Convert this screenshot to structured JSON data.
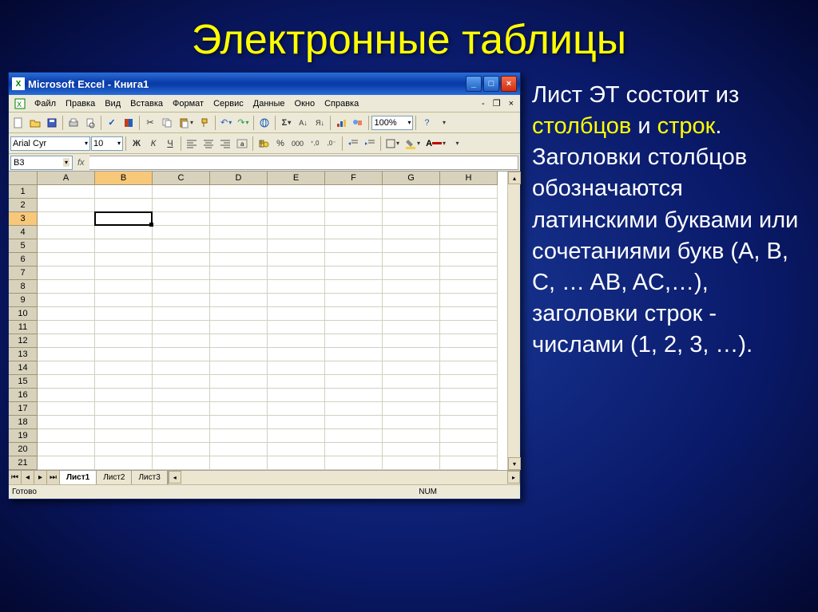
{
  "slide": {
    "title": "Электронные таблицы",
    "body_parts": {
      "p1a": "Лист ЭТ состоит из ",
      "p1b": "столбцов",
      "p1c": " и ",
      "p1d": "строк",
      "p1e": ". Заголовки столбцов обозначаются латинскими буквами или сочетаниями букв (A, B, C, … AB, AC,…), заголовки строк  - числами (1, 2, 3, …)."
    }
  },
  "chart_data": {
    "type": "table",
    "active_cell": "B3",
    "columns": [
      "A",
      "B",
      "C",
      "D",
      "E",
      "F",
      "G",
      "H"
    ],
    "rows": [
      1,
      2,
      3,
      4,
      5,
      6,
      7,
      8,
      9,
      10,
      11,
      12,
      13,
      14,
      15,
      16,
      17,
      18,
      19,
      20,
      21
    ],
    "data": {}
  },
  "excel": {
    "titlebar": "Microsoft Excel - Книга1",
    "menu": {
      "file": "Файл",
      "edit": "Правка",
      "view": "Вид",
      "insert": "Вставка",
      "format": "Формат",
      "tools": "Сервис",
      "data": "Данные",
      "window": "Окно",
      "help": "Справка"
    },
    "toolbar1": {
      "zoom": "100%"
    },
    "toolbar2": {
      "font_name": "Arial Cyr",
      "font_size": "10"
    },
    "namebox": "B3",
    "fx_label": "fx",
    "tabs": {
      "sheet1": "Лист1",
      "sheet2": "Лист2",
      "sheet3": "Лист3"
    },
    "status": {
      "ready": "Готово",
      "num": "NUM"
    }
  }
}
